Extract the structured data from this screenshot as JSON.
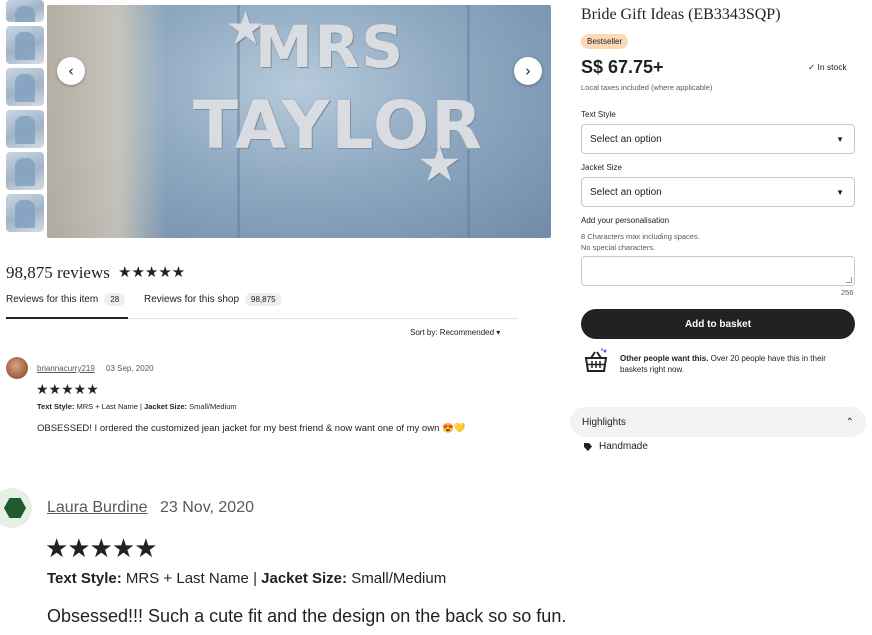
{
  "gallery": {
    "main_image_text": [
      "MRS",
      "TAYLOR"
    ],
    "thumbnail_count": 6
  },
  "reviews": {
    "total_label": "98,875 reviews",
    "stars": "★★★★★",
    "tabs": [
      {
        "label": "Reviews for this item",
        "count": "28"
      },
      {
        "label": "Reviews for this shop",
        "count": "98,875"
      }
    ],
    "sort_label": "Sort by: Recommended ▾",
    "items": [
      {
        "author": "briannacurry219",
        "date": "03 Sep, 2020",
        "stars": "★★★★★",
        "text_style_label": "Text Style:",
        "text_style_value": "MRS + Last Name",
        "jacket_size_label": "Jacket Size:",
        "jacket_size_value": "Small/Medium",
        "text": "OBSESSED! I ordered the customized jean jacket for my best friend & now want one of my own 😍💛"
      },
      {
        "author": "Laura Burdine",
        "date": "23 Nov, 2020",
        "stars": "★★★★★",
        "text_style_label": "Text Style:",
        "text_style_value": "MRS + Last Name",
        "jacket_size_label": "Jacket Size:",
        "jacket_size_value": "Small/Medium",
        "text": "Obsessed!!! Such a cute fit and the design on the back so so fun."
      }
    ]
  },
  "product": {
    "title": "Bride Gift Ideas (EB3343SQP)",
    "badge": "Bestseller",
    "price": "S$ 67.75+",
    "stock": "In stock",
    "taxes": "Local taxes included (where applicable)",
    "text_style": {
      "label": "Text Style",
      "value": "Select an option"
    },
    "jacket_size": {
      "label": "Jacket Size",
      "value": "Select an option"
    },
    "personalisation": {
      "label": "Add your personalisation",
      "note1": "8 Characters max including spaces.",
      "note2": "No special characters.",
      "counter": "256"
    },
    "add_button": "Add to basket",
    "basket_bold": "Other people want this.",
    "basket_rest": " Over 20 people have this in their baskets right now.",
    "highlights_label": "Highlights",
    "highlight_item": "Handmade"
  }
}
